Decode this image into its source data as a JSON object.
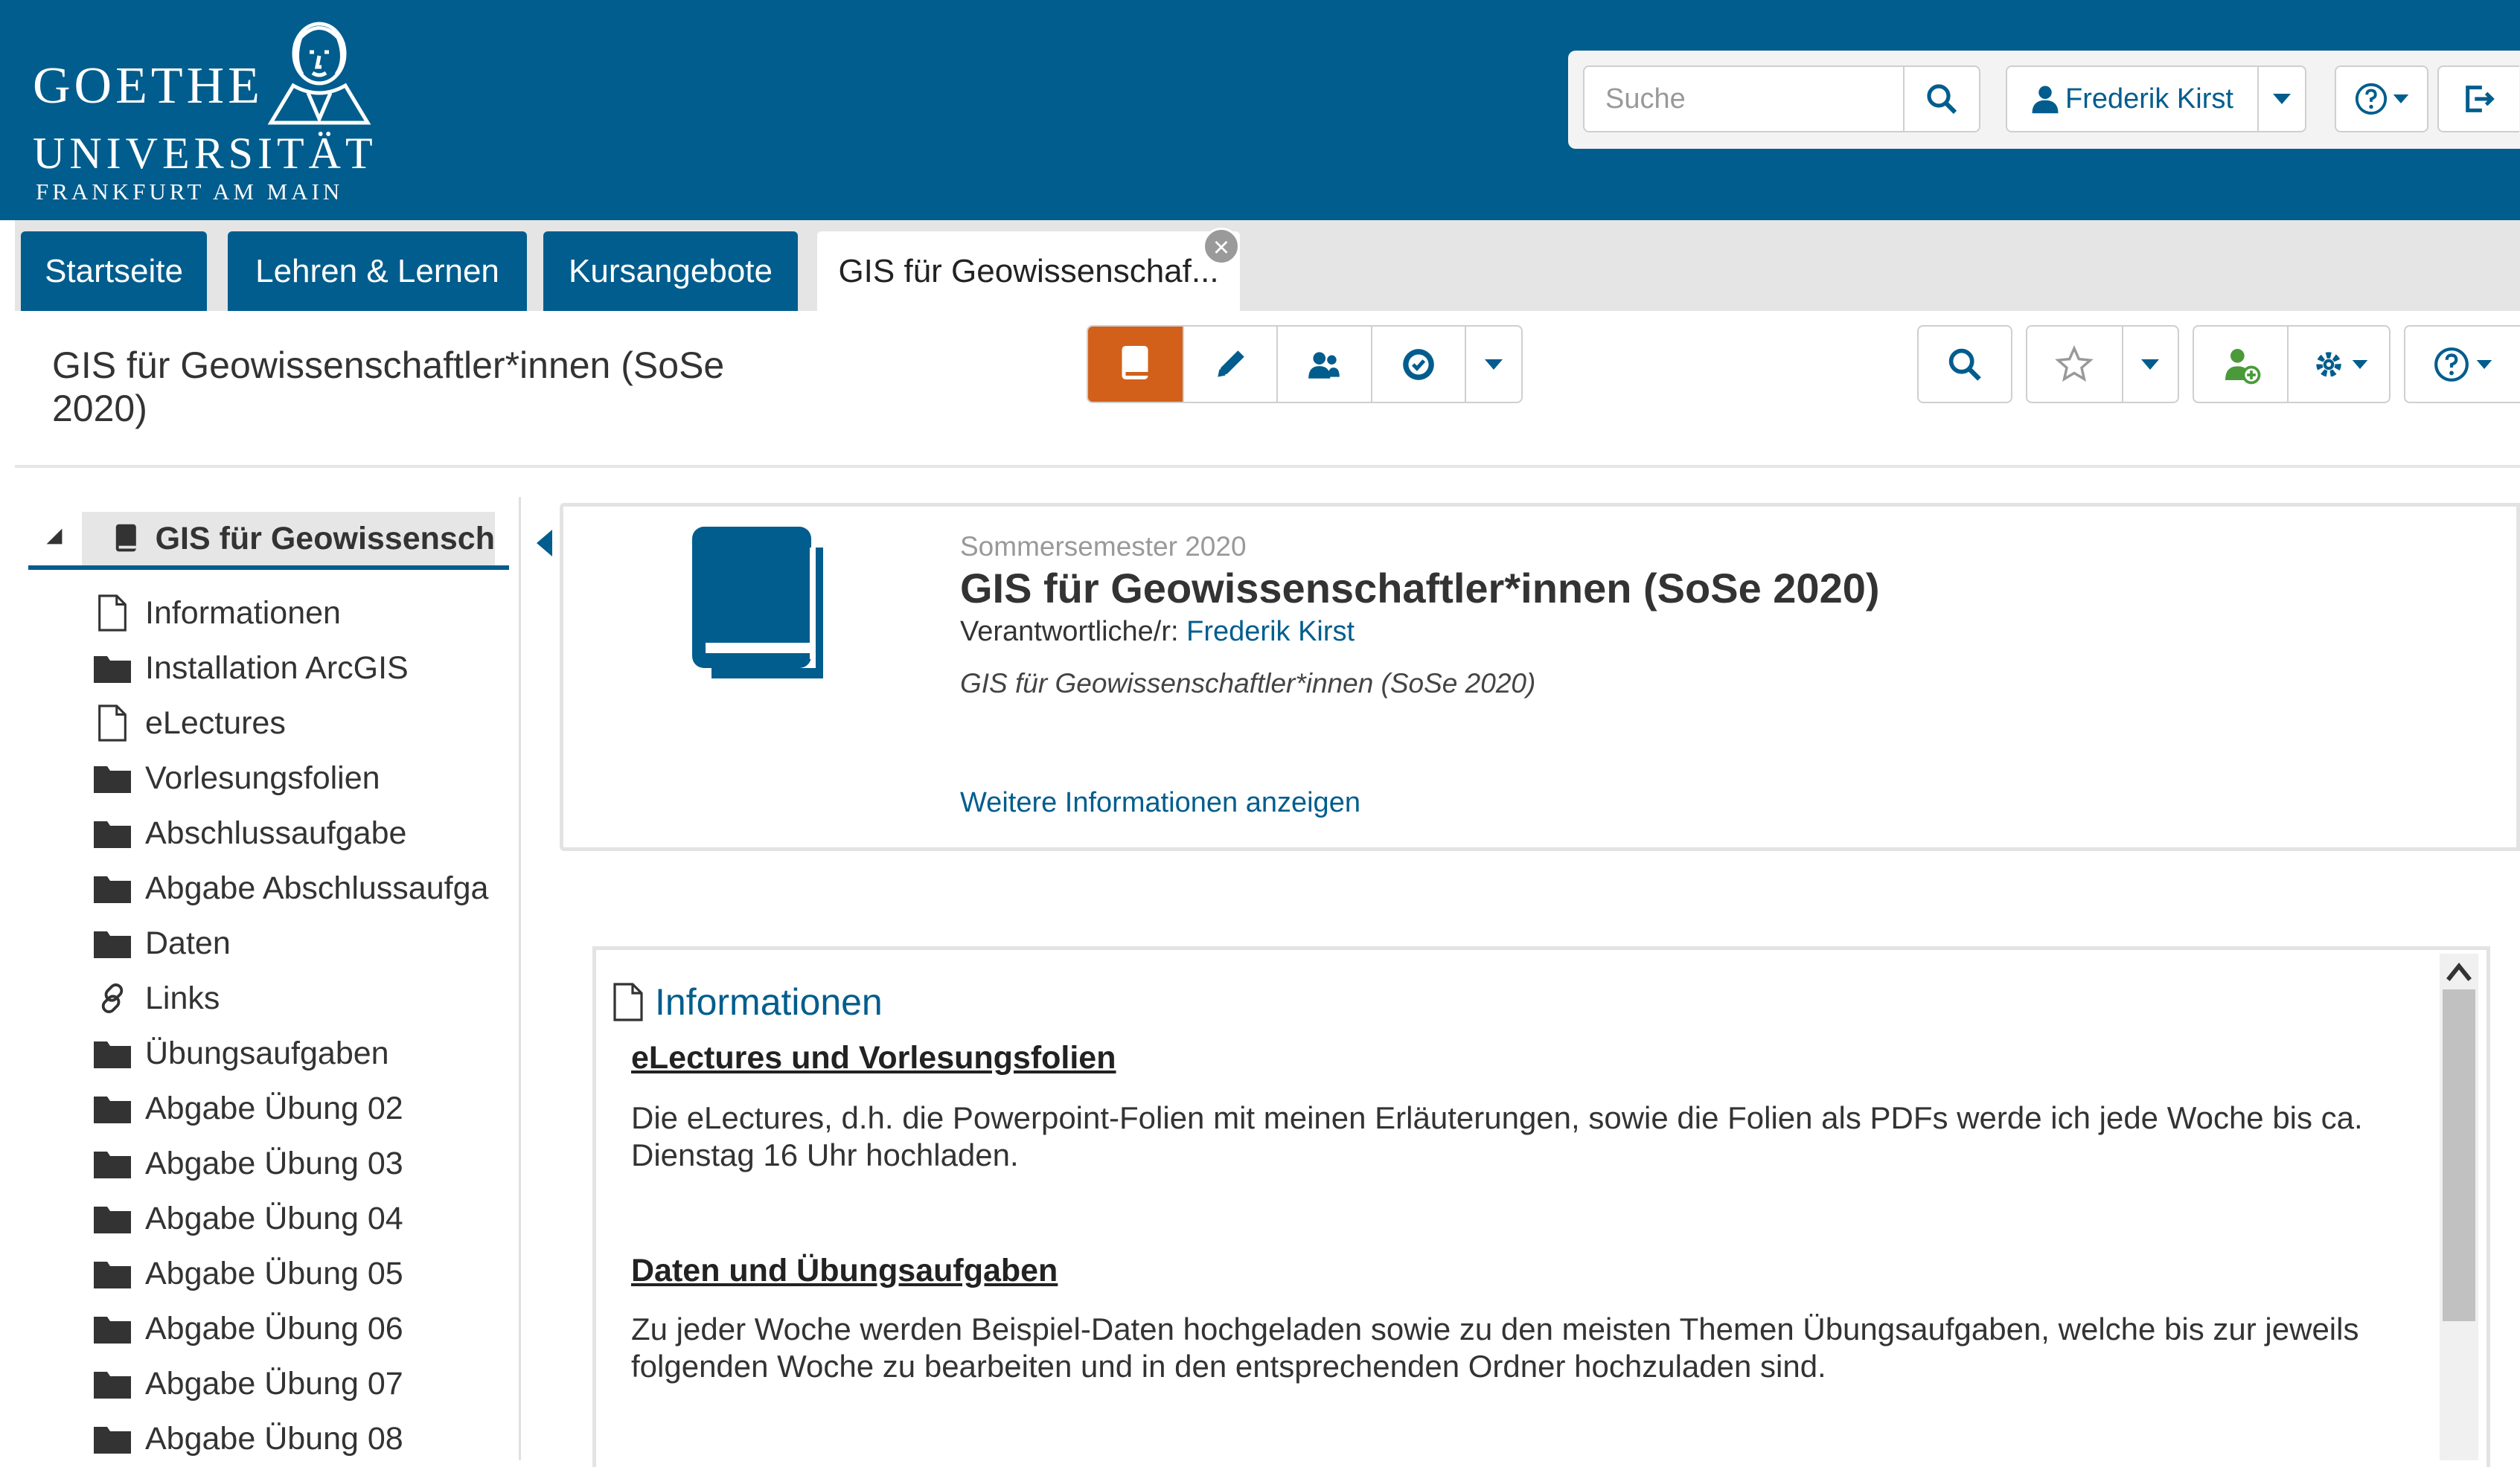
{
  "header": {
    "logo_line1": "GOETHE",
    "logo_line2": "UNIVERSITÄT",
    "logo_line3": "FRANKFURT AM MAIN",
    "search_placeholder": "Suche",
    "user_name": "Frederik Kirst",
    "brand_color": "#005d8d"
  },
  "tabs": [
    {
      "label": "Startseite"
    },
    {
      "label": "Lehren & Lernen"
    },
    {
      "label": "Kursangebote"
    },
    {
      "label": "GIS für Geowissenschaf..."
    }
  ],
  "page": {
    "title": "GIS für Geowissenschaftler*innen (SoSe 2020)",
    "view_tabs": [
      "book-icon",
      "pencil-icon",
      "members-icon",
      "badge-icon",
      "dropdown-caret-icon"
    ],
    "active_tab_color": "#d2601a"
  },
  "tree": {
    "root": "GIS für Geowissensch",
    "items": [
      {
        "label": "Informationen",
        "icon": "file-icon"
      },
      {
        "label": "Installation ArcGIS",
        "icon": "folder-icon"
      },
      {
        "label": "eLectures",
        "icon": "file-icon"
      },
      {
        "label": "Vorlesungsfolien",
        "icon": "folder-icon"
      },
      {
        "label": "Abschlussaufgabe",
        "icon": "folder-icon"
      },
      {
        "label": "Abgabe Abschlussaufga",
        "icon": "folder-icon"
      },
      {
        "label": "Daten",
        "icon": "folder-icon"
      },
      {
        "label": "Links",
        "icon": "link-icon"
      },
      {
        "label": "Übungsaufgaben",
        "icon": "folder-icon"
      },
      {
        "label": "Abgabe Übung 02",
        "icon": "folder-icon"
      },
      {
        "label": "Abgabe Übung 03",
        "icon": "folder-icon"
      },
      {
        "label": "Abgabe Übung 04",
        "icon": "folder-icon"
      },
      {
        "label": "Abgabe Übung 05",
        "icon": "folder-icon"
      },
      {
        "label": "Abgabe Übung 06",
        "icon": "folder-icon"
      },
      {
        "label": "Abgabe Übung 07",
        "icon": "folder-icon"
      },
      {
        "label": "Abgabe Übung 08",
        "icon": "folder-icon"
      }
    ]
  },
  "card": {
    "semester": "Sommersemester 2020",
    "title": "GIS für Geowissenschaftler*innen (SoSe 2020)",
    "responsible_label": "Verantwortliche/r:",
    "responsible_name": "Frederik Kirst",
    "description": "GIS für Geowissenschaftler*innen (SoSe 2020)",
    "more_info": "Weitere Informationen anzeigen"
  },
  "content": {
    "heading": "Informationen",
    "sections": [
      {
        "title": "eLectures und Vorlesungsfolien",
        "text": "Die eLectures, d.h. die Powerpoint-Folien mit meinen Erläuterungen, sowie die Folien als PDFs werde ich jede Woche bis ca. Dienstag 16 Uhr hochladen."
      },
      {
        "title": "Daten und Übungsaufgaben",
        "text": "Zu jeder Woche werden Beispiel-Daten hochgeladen sowie zu den meisten Themen Übungsaufgaben, welche bis zur jeweils folgenden Woche zu bearbeiten und in den entsprechenden Ordner hochzuladen sind."
      }
    ]
  }
}
